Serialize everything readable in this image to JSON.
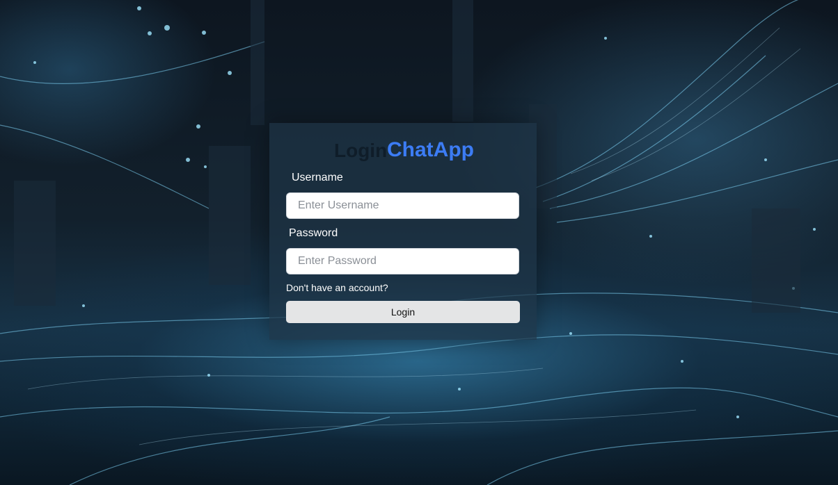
{
  "app": {
    "title": "ChatApp",
    "ghost_title": "Login",
    "accent_color": "#3c7cf4"
  },
  "form": {
    "username_label": "Username",
    "username_placeholder": "Enter Username",
    "username_value": "",
    "password_label": "Password",
    "password_placeholder": "Enter Password",
    "password_value": "",
    "register_link": "Don't have an account?",
    "login_button": "Login"
  }
}
